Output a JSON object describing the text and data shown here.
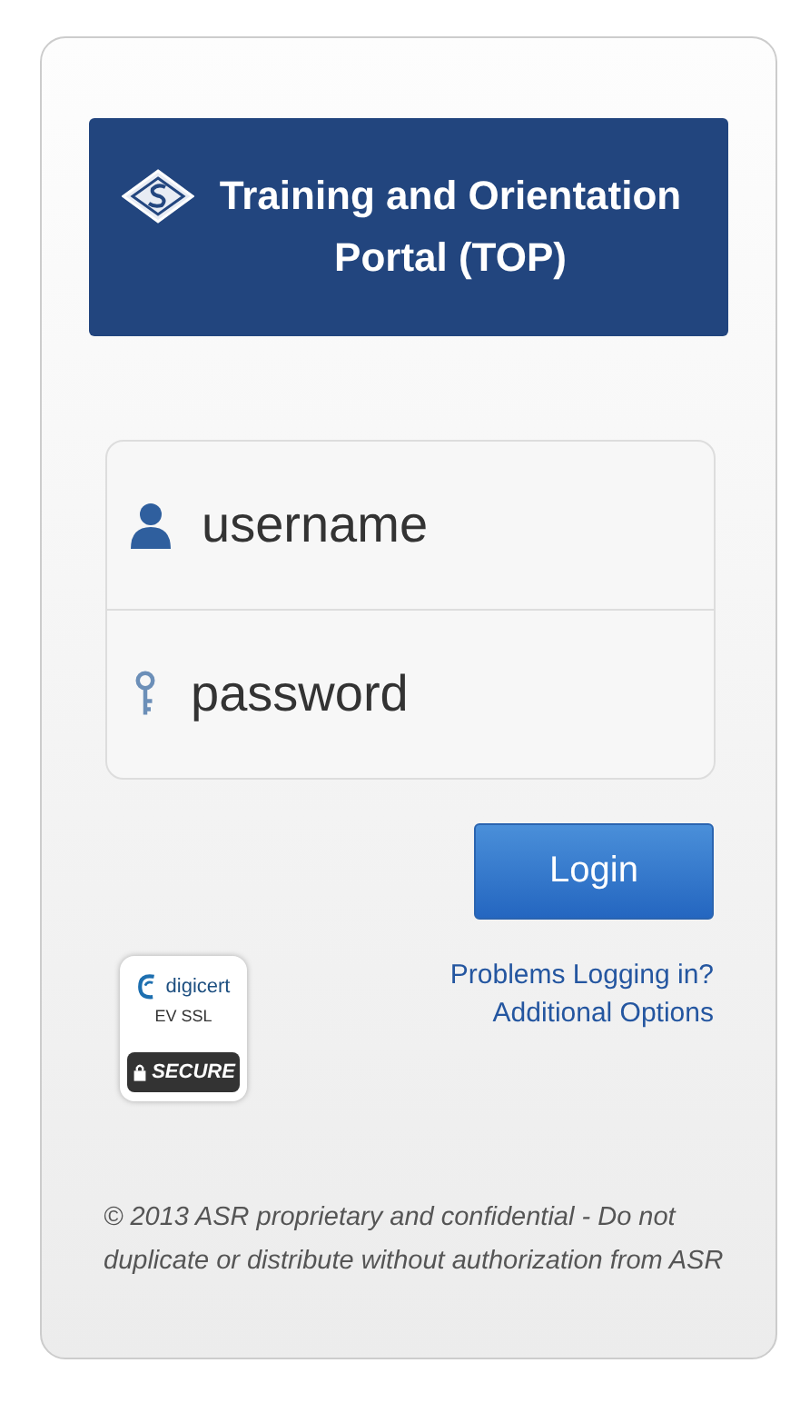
{
  "header": {
    "title": "Training and Orientation Portal (TOP)"
  },
  "fields": [
    {
      "kind": "username",
      "placeholder": "username"
    },
    {
      "kind": "password",
      "placeholder": "password"
    }
  ],
  "login_button": "Login",
  "badge": {
    "brand": "digicert",
    "type": "EV SSL",
    "status": "SECURE"
  },
  "links": [
    "Problems Logging in?",
    "Additional Options"
  ],
  "footer": "© 2013 ASR proprietary and confidential - Do not duplicate or distribute without authorization from ASR"
}
